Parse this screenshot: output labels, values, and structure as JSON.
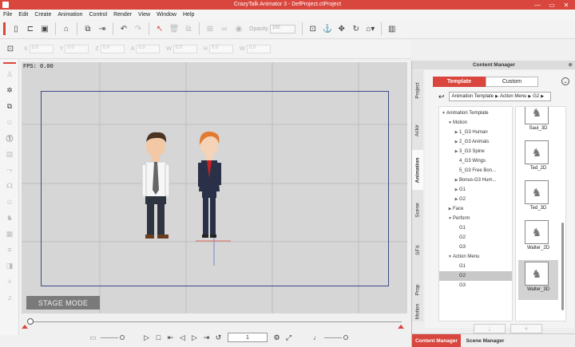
{
  "window": {
    "title": "CrazyTalk Animator 3  -  DefProject.ctProject",
    "min": "—",
    "max": "▭",
    "close": "✕"
  },
  "menu": [
    "File",
    "Edit",
    "Create",
    "Animation",
    "Control",
    "Render",
    "View",
    "Window",
    "Help"
  ],
  "toolbar": {
    "opacity_label": "Opacity",
    "opacity_value": "100"
  },
  "transform": {
    "fields": [
      {
        "label": "X",
        "value": "0.0"
      },
      {
        "label": "Y",
        "value": "0.0"
      },
      {
        "label": "Z",
        "value": "0.0"
      },
      {
        "label": "A",
        "value": "0.0"
      },
      {
        "label": "W",
        "value": "0.0"
      },
      {
        "label": "H",
        "value": "0.0"
      },
      {
        "label": "W",
        "value": "0.0"
      }
    ]
  },
  "stage": {
    "fps": "FPS: 0.00",
    "mode_label": "STAGE MODE"
  },
  "playback": {
    "frame": "1"
  },
  "panel": {
    "title": "Content Manager",
    "side_tabs": [
      "Project",
      "Actor",
      "Animation",
      "Scene",
      "SFX",
      "Prop",
      "Motion"
    ],
    "tabs": [
      "Template",
      "Custom"
    ],
    "path": [
      "Animation Template",
      "Action Menu",
      "G2"
    ],
    "tree": [
      {
        "label": "Animation Template",
        "arrow": "▼",
        "indent": 0
      },
      {
        "label": "Motion",
        "arrow": "▼",
        "indent": 1
      },
      {
        "label": "1_G3 Human",
        "arrow": "▶",
        "indent": 2
      },
      {
        "label": "2_G3 Animals",
        "arrow": "▶",
        "indent": 2
      },
      {
        "label": "3_G3 Spine",
        "arrow": "▶",
        "indent": 2
      },
      {
        "label": "4_G3 Wings",
        "arrow": "",
        "indent": 2
      },
      {
        "label": "5_G3 Free Bon...",
        "arrow": "",
        "indent": 2
      },
      {
        "label": "Bonus-G3 Hum...",
        "arrow": "▶",
        "indent": 2
      },
      {
        "label": "G1",
        "arrow": "▶",
        "indent": 2
      },
      {
        "label": "G2",
        "arrow": "▶",
        "indent": 2
      },
      {
        "label": "Face",
        "arrow": "▶",
        "indent": 1
      },
      {
        "label": "Perform",
        "arrow": "▼",
        "indent": 1
      },
      {
        "label": "G1",
        "arrow": "",
        "indent": 2
      },
      {
        "label": "G2",
        "arrow": "",
        "indent": 2
      },
      {
        "label": "G3",
        "arrow": "",
        "indent": 2
      },
      {
        "label": "Action Menu",
        "arrow": "▼",
        "indent": 1
      },
      {
        "label": "G1",
        "arrow": "",
        "indent": 2
      },
      {
        "label": "G2",
        "arrow": "",
        "indent": 2,
        "selected": true
      },
      {
        "label": "G3",
        "arrow": "",
        "indent": 2
      }
    ],
    "thumbnails": [
      "Saul_3D",
      "Ted_2D",
      "Ted_3D",
      "Walter_2D",
      "Walter_3D"
    ],
    "bottom_tabs": [
      "Content Manager",
      "Scene Manager"
    ]
  },
  "colors": {
    "accent": "#d9463e",
    "stage_bg": "#d6d6d6",
    "frame": "#3c4a8a"
  }
}
